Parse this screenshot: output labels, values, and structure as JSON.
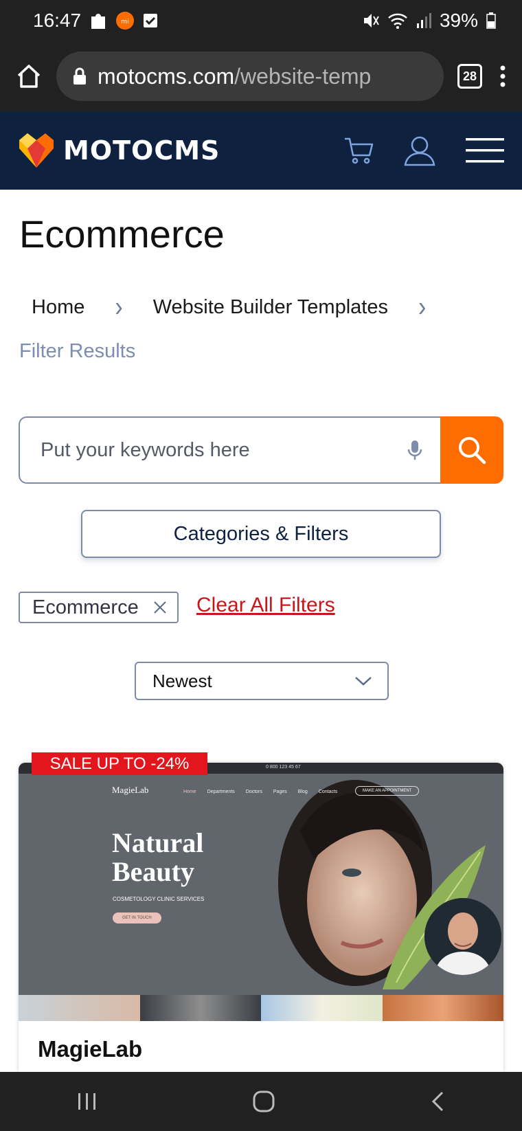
{
  "status_bar": {
    "time": "16:47",
    "battery": "39%"
  },
  "browser": {
    "url_host": "motocms.com",
    "url_path": "/website-temp",
    "tab_count": "28"
  },
  "header": {
    "brand": "MOTOCMS"
  },
  "page": {
    "title": "Ecommerce",
    "breadcrumb": {
      "home": "Home",
      "section": "Website Builder Templates",
      "current": "Filter Results"
    }
  },
  "search": {
    "placeholder": "Put your keywords here"
  },
  "filters_button": "Categories & Filters",
  "active_filter": {
    "label": "Ecommerce"
  },
  "clear_filters": "Clear All Filters",
  "sort": {
    "selected": "Newest"
  },
  "card": {
    "sale": "SALE UP TO -24%",
    "title": "MagieLab",
    "preview": {
      "logo": "MagieLab",
      "nav": [
        "Home",
        "Departments",
        "Doctors",
        "Pages",
        "Blog",
        "Contacts"
      ],
      "appointment": "MAKE AN APPOINTMENT",
      "hero_line1": "Natural",
      "hero_line2": "Beauty",
      "subtitle": "COSMETOLOGY CLINIC SERVICES",
      "cta": "GET IN TOUCH",
      "phone": "0 800 123 45 67"
    }
  },
  "colors": {
    "brand_navy": "#0e2240",
    "accent_orange": "#ff6d00",
    "sale_red": "#e3161d",
    "link_red": "#c8161d"
  }
}
